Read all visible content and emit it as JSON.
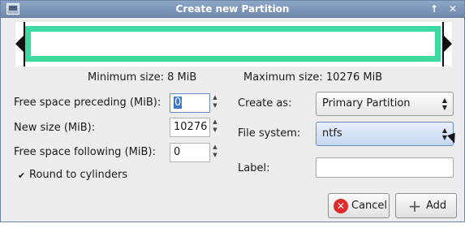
{
  "window": {
    "title": "Create new Partition"
  },
  "titlebar": {
    "up_glyph": "↑",
    "close_glyph": "✕"
  },
  "sizes": {
    "minimum": "Minimum size: 8 MiB",
    "maximum": "Maximum size: 10276 MiB"
  },
  "fields": {
    "free_preceding_label": "Free space preceding (MiB):",
    "free_preceding_value": "0",
    "new_size_label": "New size (MiB):",
    "new_size_value": "10276",
    "free_following_label": "Free space following (MiB):",
    "free_following_value": "0",
    "round_label": "Round to cylinders",
    "round_checked": "✔"
  },
  "options": {
    "create_as_label": "Create as:",
    "create_as_value": "Primary Partition",
    "filesystem_label": "File system:",
    "filesystem_value": "ntfs",
    "label_label": "Label:",
    "label_value": ""
  },
  "buttons": {
    "cancel": "Cancel",
    "add": "Add"
  },
  "colors": {
    "partition_bar": "#3fd9a2",
    "titlebar": "#7f98bb"
  }
}
